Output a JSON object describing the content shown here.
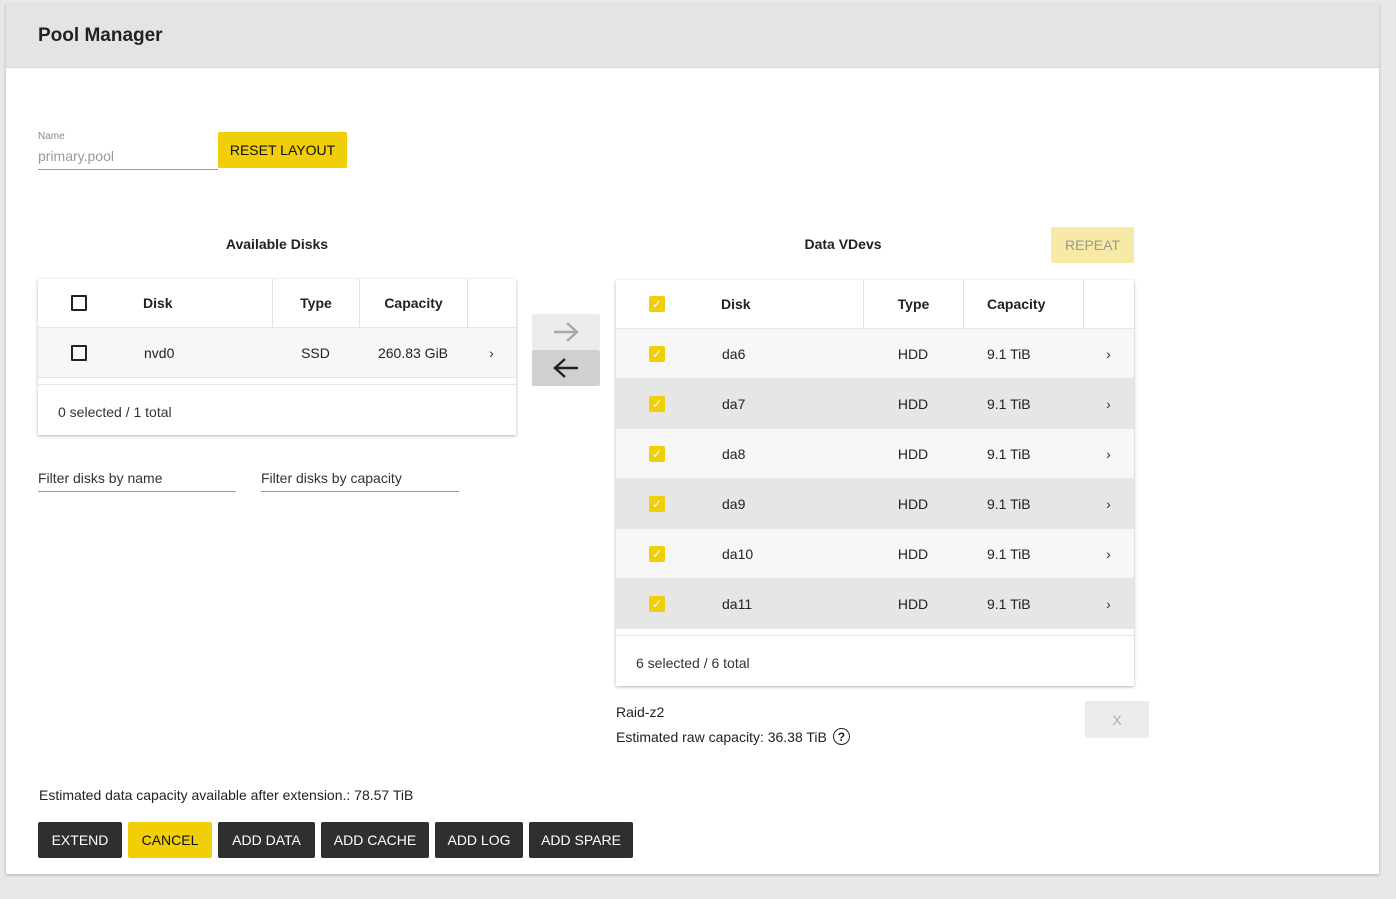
{
  "header": {
    "title": "Pool Manager"
  },
  "name_field": {
    "label": "Name",
    "value": "primary.pool"
  },
  "reset_button": "RESET LAYOUT",
  "available": {
    "title": "Available Disks",
    "columns": [
      "Disk",
      "Type",
      "Capacity"
    ],
    "rows": [
      {
        "disk": "nvd0",
        "type": "SSD",
        "capacity": "260.83 GiB",
        "checked": false
      }
    ],
    "footer": "0 selected / 1 total",
    "filter_name_placeholder": "Filter disks by name",
    "filter_capacity_placeholder": "Filter disks by capacity"
  },
  "move": {
    "right_icon": "arrow-right-icon",
    "left_icon": "arrow-left-icon"
  },
  "vdevs": {
    "title": "Data VDevs",
    "repeat_button": "REPEAT",
    "columns": [
      "Disk",
      "Type",
      "Capacity"
    ],
    "rows": [
      {
        "disk": "da6",
        "type": "HDD",
        "capacity": "9.1 TiB",
        "checked": true
      },
      {
        "disk": "da7",
        "type": "HDD",
        "capacity": "9.1 TiB",
        "checked": true
      },
      {
        "disk": "da8",
        "type": "HDD",
        "capacity": "9.1 TiB",
        "checked": true
      },
      {
        "disk": "da9",
        "type": "HDD",
        "capacity": "9.1 TiB",
        "checked": true
      },
      {
        "disk": "da10",
        "type": "HDD",
        "capacity": "9.1 TiB",
        "checked": true
      },
      {
        "disk": "da11",
        "type": "HDD",
        "capacity": "9.1 TiB",
        "checked": true
      }
    ],
    "footer": "6 selected / 6 total",
    "layout": "Raid-z2",
    "raw_capacity": "Estimated raw capacity: 36.38 TiB",
    "remove_button": "X"
  },
  "estimate": "Estimated data capacity available after extension.: 78.57 TiB",
  "actions": {
    "extend": "EXTEND",
    "cancel": "CANCEL",
    "add_data": "ADD DATA",
    "add_cache": "ADD CACHE",
    "add_log": "ADD LOG",
    "add_spare": "ADD SPARE"
  },
  "colors": {
    "accent": "#f0ce08",
    "dark": "#2f2f2f",
    "row_alt": "#e6e6e6"
  }
}
